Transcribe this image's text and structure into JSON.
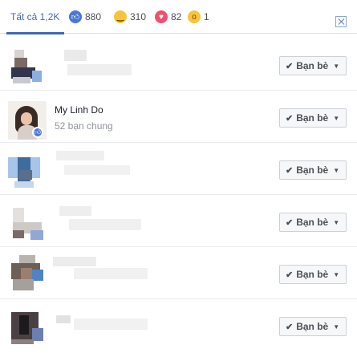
{
  "tabs": {
    "all": {
      "label": "Tất cả 1,2K"
    },
    "like": {
      "count": "880",
      "icon": "like-icon"
    },
    "haha": {
      "count": "310",
      "icon": "haha-icon"
    },
    "love": {
      "count": "82",
      "icon": "love-icon"
    },
    "wow": {
      "count": "1",
      "icon": "wow-icon"
    }
  },
  "close": {
    "icon": "close-icon"
  },
  "rows": [
    {
      "name": "",
      "mutual": "",
      "button": "Bạn bè"
    },
    {
      "name": "My Linh Do",
      "mutual": "52 bạn chung",
      "button": "Bạn bè"
    },
    {
      "name": "",
      "mutual": "",
      "button": "Bạn bè"
    },
    {
      "name": "",
      "mutual": "",
      "button": "Bạn bè"
    },
    {
      "name": "",
      "mutual": "",
      "button": "Bạn bè"
    },
    {
      "name": "",
      "mutual": "",
      "button": "Bạn bè"
    }
  ],
  "colors": {
    "accent": "#4267b2",
    "like": "#4a76d9",
    "love": "#f0506e",
    "haha": "#f7c53a"
  }
}
